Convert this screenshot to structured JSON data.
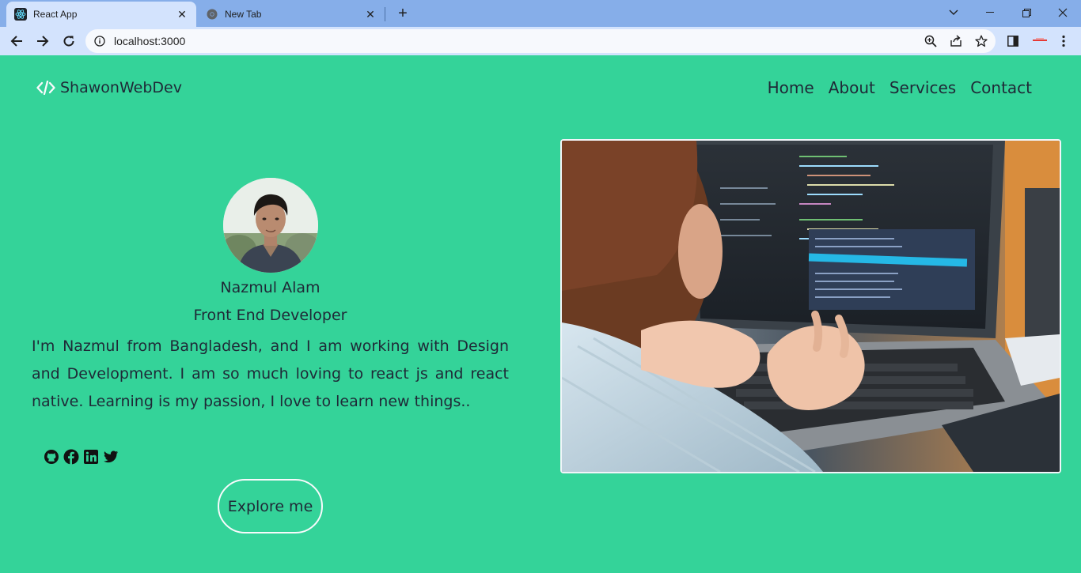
{
  "browser": {
    "tabs": [
      {
        "title": "React App",
        "active": true
      },
      {
        "title": "New Tab",
        "active": false
      }
    ],
    "address": "localhost:3000"
  },
  "site": {
    "brand": "ShawonWebDev",
    "nav": [
      "Home",
      "About",
      "Services",
      "Contact"
    ]
  },
  "profile": {
    "name": "Nazmul Alam",
    "role": "Front End Developer",
    "bio": "I'm Nazmul from Bangladesh, and I am working with Design and Development. I am so much loving to react js and react native. Learning is my passion, I love to learn new things..",
    "socials": [
      "github-icon",
      "facebook-icon",
      "linkedin-icon",
      "twitter-icon"
    ],
    "cta": "Explore me"
  },
  "colors": {
    "page_background": "#34d399",
    "text": "#1f2937",
    "button_border": "#f8fafc"
  }
}
